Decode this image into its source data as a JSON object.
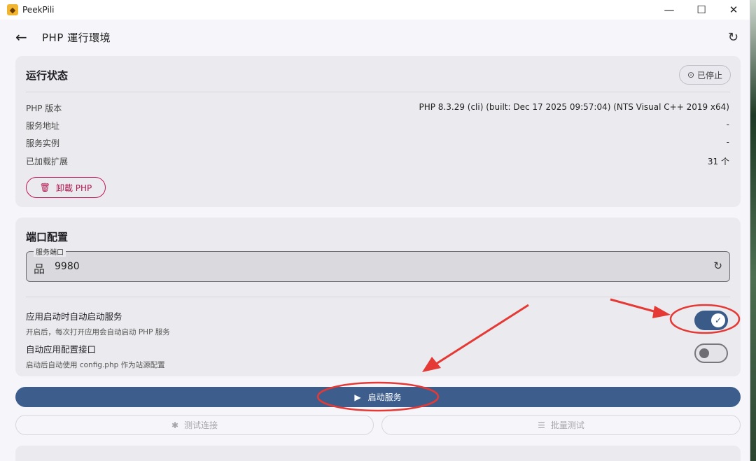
{
  "window": {
    "app_title": "PeekPili",
    "minimize_glyph": "—",
    "maximize_glyph": "☐",
    "close_glyph": "✕"
  },
  "header": {
    "title": "PHP 運行環境",
    "back_icon": "arrow-left-icon",
    "refresh_icon": "refresh-icon"
  },
  "status_card": {
    "title": "运行状态",
    "badge": "已停止",
    "rows": [
      {
        "label": "PHP 版本",
        "value": "PHP 8.3.29 (cli) (built: Dec 17 2025 09:57:04) (NTS Visual C++ 2019 x64)"
      },
      {
        "label": "服务地址",
        "value": "-"
      },
      {
        "label": "服务实例",
        "value": "-"
      },
      {
        "label": "已加载扩展",
        "value": "31 个"
      }
    ],
    "uninstall_label": "卸載 PHP"
  },
  "port_card": {
    "title": "端口配置",
    "field_label": "服务端口",
    "field_value": "9980",
    "settings": [
      {
        "title": "应用启动时自动启动服务",
        "desc": "开启后，每次打开应用会自动启动 PHP 服务",
        "enabled": true
      },
      {
        "title": "自动应用配置接口",
        "desc": "启动后自动使用 config.php 作为站源配置",
        "enabled": false
      }
    ]
  },
  "actions": {
    "start_label": "启动服务",
    "test_label": "测试连接",
    "batch_label": "批量测试"
  },
  "colors": {
    "accent": "#3d5e8c",
    "danger": "#c2185b",
    "annotation": "#e53935"
  }
}
